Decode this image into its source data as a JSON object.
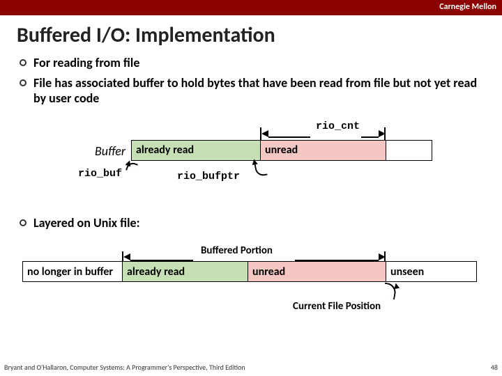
{
  "brand": "Carnegie Mellon",
  "title": "Buffered I/O: Implementation",
  "bullets": [
    "For reading from file",
    "File has associated buffer to hold bytes that have been read from file but not yet read by user code",
    "Layered on Unix file:"
  ],
  "diagram1": {
    "rio_cnt": "rio_cnt",
    "buffer_label": "Buffer",
    "already_read": "already read",
    "unread": "unread",
    "rio_buf": "rio_buf",
    "rio_bufptr": "rio_bufptr"
  },
  "diagram2": {
    "buffered_portion": "Buffered Portion",
    "no_longer": "no longer in buffer",
    "already_read": "already read",
    "unread": "unread",
    "unseen": "unseen",
    "current_file_position": "Current File Position"
  },
  "footer": {
    "left": "Bryant and O'Hallaron, Computer Systems: A Programmer's Perspective, Third Edition",
    "right": "48"
  }
}
